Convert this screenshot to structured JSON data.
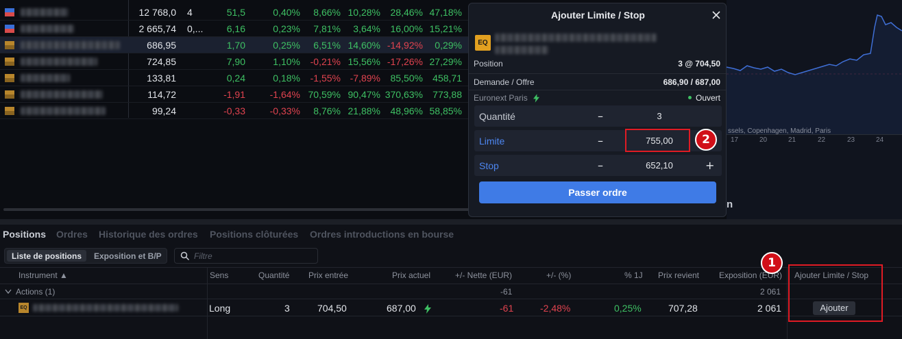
{
  "watchlist": {
    "rows": [
      {
        "flag": [
          "#3a6fd8",
          "#d94b4b"
        ],
        "price": "12 768,0",
        "qty": "4",
        "chg": "51,5",
        "pct": "0,40%",
        "p1": "8,66%",
        "p2": "10,28%",
        "p3": "28,46%",
        "p4": "47,18%",
        "colors": [
          "pos",
          "pos",
          "pos",
          "pos",
          "pos",
          "pos"
        ]
      },
      {
        "flag": [
          "#3a6fd8",
          "#d94b4b"
        ],
        "price": "2 665,74",
        "qty": "0,...",
        "chg": "6,16",
        "pct": "0,23%",
        "p1": "7,81%",
        "p2": "3,64%",
        "p3": "16,00%",
        "p4": "15,21%",
        "colors": [
          "pos",
          "pos",
          "pos",
          "pos",
          "pos",
          "pos"
        ]
      },
      {
        "flag": [
          "#b8862c",
          "#8a6420"
        ],
        "price": "686,95",
        "qty": "",
        "chg": "1,70",
        "pct": "0,25%",
        "p1": "6,51%",
        "p2": "14,60%",
        "p3": "-14,92%",
        "p4": "0,29%",
        "colors": [
          "pos",
          "pos",
          "pos",
          "pos",
          "neg",
          "pos"
        ]
      },
      {
        "flag": [
          "#b8862c",
          "#8a6420"
        ],
        "price": "724,85",
        "qty": "",
        "chg": "7,90",
        "pct": "1,10%",
        "p1": "-0,21%",
        "p2": "15,56%",
        "p3": "-17,26%",
        "p4": "27,29%",
        "colors": [
          "pos",
          "pos",
          "neg",
          "pos",
          "neg",
          "pos"
        ]
      },
      {
        "flag": [
          "#b8862c",
          "#8a6420"
        ],
        "price": "133,81",
        "qty": "",
        "chg": "0,24",
        "pct": "0,18%",
        "p1": "-1,55%",
        "p2": "-7,89%",
        "p3": "85,50%",
        "p4": "458,71",
        "colors": [
          "pos",
          "pos",
          "neg",
          "neg",
          "pos",
          "pos"
        ]
      },
      {
        "flag": [
          "#b8862c",
          "#8a6420"
        ],
        "price": "114,72",
        "qty": "",
        "chg": "-1,91",
        "pct": "-1,64%",
        "p1": "70,59%",
        "p2": "90,47%",
        "p3": "370,63%",
        "p4": "773,88",
        "colors": [
          "neg",
          "neg",
          "pos",
          "pos",
          "pos",
          "pos"
        ]
      },
      {
        "flag": [
          "#b8862c",
          "#8a6420"
        ],
        "price": "99,24",
        "qty": "",
        "chg": "-0,33",
        "pct": "-0,33%",
        "p1": "8,76%",
        "p2": "21,88%",
        "p3": "48,96%",
        "p4": "58,85%",
        "colors": [
          "neg",
          "neg",
          "pos",
          "pos",
          "pos",
          "pos"
        ]
      }
    ]
  },
  "chart": {
    "exchanges_text": "ssels, Copenhagen, Madrid, Paris",
    "axis_labels": [
      "17",
      "20",
      "21",
      "22",
      "23",
      "24"
    ],
    "tail_text": "n",
    "line_color": "#3f6fd6",
    "ref_line_color": "#c0404a"
  },
  "dialog": {
    "title": "Ajouter Limite / Stop",
    "badge": "EQ",
    "position_label": "Position",
    "position_value": "3 @ 704,50",
    "bidask_label": "Demande / Offre",
    "bidask_value": "686,90 / 687,00",
    "exchange": "Euronext Paris",
    "status": "Ouvert",
    "quantity_label": "Quantité",
    "quantity_value": "3",
    "limit_label": "Limite",
    "limit_value": "755,00",
    "stop_label": "Stop",
    "stop_value": "652,10",
    "submit_label": "Passer ordre",
    "minus": "–",
    "plus": "+"
  },
  "bottom": {
    "tabs": [
      "Positions",
      "Ordres",
      "Historique des ordres",
      "Positions clôturées",
      "Ordres introductions en bourse"
    ],
    "segments": [
      "Liste de positions",
      "Exposition et B/P"
    ],
    "filter_placeholder": "Filtre",
    "columns": {
      "instrument": "Instrument ▲",
      "sens": "Sens",
      "quantite": "Quantité",
      "prix_entree": "Prix entrée",
      "prix_actuel": "Prix actuel",
      "nette": "+/- Nette (EUR)",
      "pct": "+/- (%)",
      "pct1j": "% 1J",
      "prix_revient": "Prix revient",
      "exposition": "Exposition (EUR)",
      "ajouter": "Ajouter Limite / Stop"
    },
    "group": {
      "label": "Actions (1)",
      "nette": "-61",
      "exposition": "2 061"
    },
    "row": {
      "badge": "EQ",
      "sens": "Long",
      "quantite": "3",
      "prix_entree": "704,50",
      "prix_actuel": "687,00",
      "nette": "-61",
      "pct": "-2,48%",
      "pct1j": "0,25%",
      "prix_revient": "707,28",
      "exposition": "2 061",
      "button": "Ajouter"
    }
  },
  "annotations": {
    "badge1": "1",
    "badge2": "2",
    "color": "#e01b24"
  }
}
